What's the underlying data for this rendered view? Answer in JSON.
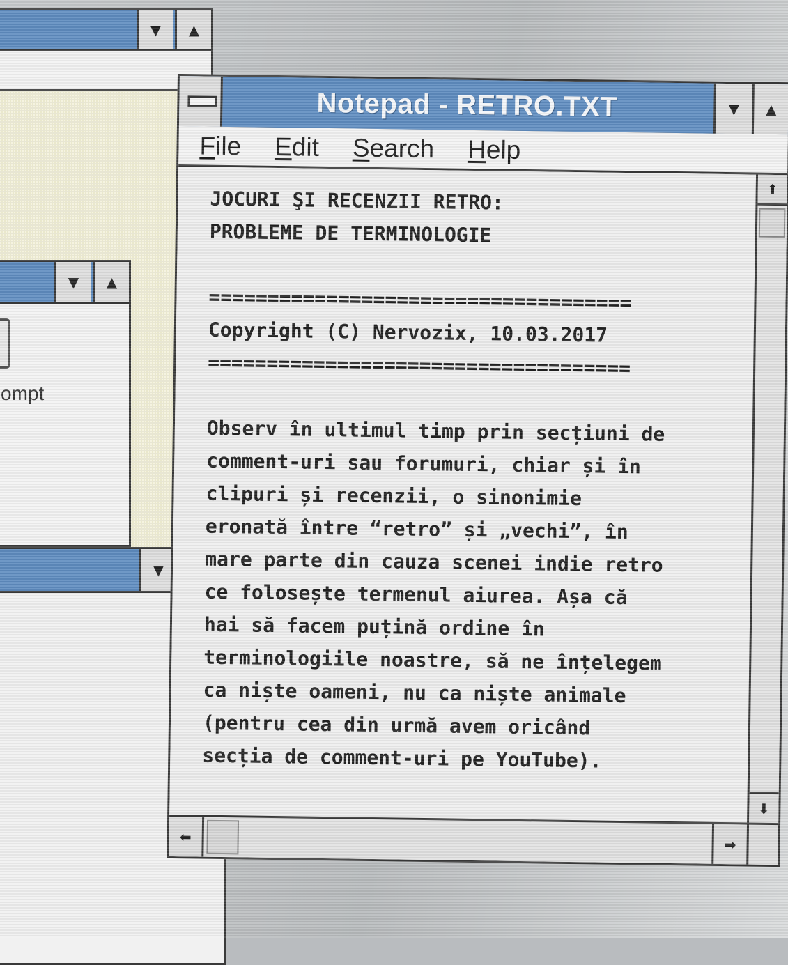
{
  "notepad": {
    "title": "Notepad - RETRO.TXT",
    "menu": [
      {
        "key": "F",
        "rest": "ile"
      },
      {
        "key": "E",
        "rest": "dit"
      },
      {
        "key": "S",
        "rest": "earch"
      },
      {
        "key": "H",
        "rest": "elp"
      }
    ],
    "lines": [
      "JOCURI ŞI RECENZII RETRO:",
      "PROBLEME DE TERMINOLOGIE",
      "",
      "====================================",
      "Copyright (C) Nervozix, 10.03.2017",
      "====================================",
      "",
      "Observ în ultimul timp prin secțiuni de",
      "comment-uri sau forumuri, chiar și în",
      "clipuri și recenzii, o sinonimie",
      "eronată între “retro” și „vechi”, în",
      "mare parte din cauza scenei indie retro",
      "ce folosește termenul aiurea. Așa că",
      "hai să facem puțină ordine în",
      "terminologiile noastre, să ne înțelegem",
      "ca niște oameni, nu ca niște animale",
      "(pentru cea din urmă avem oricând",
      "secția de comment-uri pe YouTube)."
    ]
  },
  "background_window": {
    "icon_label_fragment": "ompt"
  },
  "icons": {
    "minimize": "▼",
    "maximize": "▲",
    "scroll_up": "⬆",
    "scroll_down": "⬇",
    "scroll_left": "⬅",
    "scroll_right": "➡"
  }
}
